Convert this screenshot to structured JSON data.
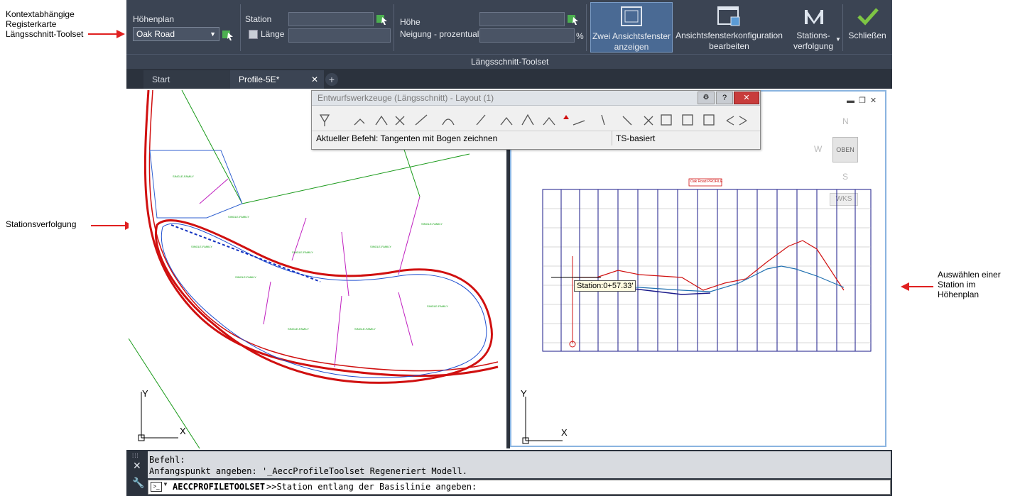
{
  "annotations": {
    "context_tab": "Kontextabhängige Registerkarte Längsschnitt-Toolset",
    "station_tracking": "Stationsverfolgung",
    "select_station": "Auswählen einer Station im Höhenplan"
  },
  "ribbon": {
    "profile_view_label": "Höhenplan",
    "profile_view_value": "Oak Road",
    "station_label": "Station",
    "length_label": "Länge",
    "elevation_label": "Höhe",
    "grade_label": "Neigung - prozentual",
    "percent_sign": "%",
    "two_viewports_label": "Zwei Ansichtsfenster anzeigen",
    "edit_viewport_config_label": "Ansichtsfensterkonfiguration bearbeiten",
    "station_tracking_label": "Stations-verfolgung",
    "close_label": "Schließen",
    "panel_title": "Längsschnitt-Toolset"
  },
  "tabs": {
    "start": "Start",
    "profile": "Profile-5E*"
  },
  "palette": {
    "title": "Entwurfswerkzeuge (Längsschnitt) - Layout (1)",
    "current_command": "Aktueller Befehl: Tangenten mit Bogen zeichnen",
    "mode": "TS-basiert"
  },
  "viewcube": {
    "north": "N",
    "south": "S",
    "west": "W",
    "top": "OBEN",
    "wcs": "WKS"
  },
  "drawing": {
    "station_tooltip": "Station:0+57.33'",
    "profile_title": "Oak Road PROFILE",
    "axis_y": "Y",
    "axis_x": "X"
  },
  "command_line": {
    "line1": "Befehl:",
    "line2": "Anfangspunkt angeben: '_AeccProfileToolset Regeneriert Modell.",
    "command_name": "AECCPROFILETOOLSET",
    "prompt": ">>Station entlang der Basislinie angeben:"
  },
  "colors": {
    "ribbon_bg": "#3b4453",
    "accent_blue": "#5b9bd5",
    "close_green": "#7ec544",
    "annotation_arrow": "#e02020"
  }
}
